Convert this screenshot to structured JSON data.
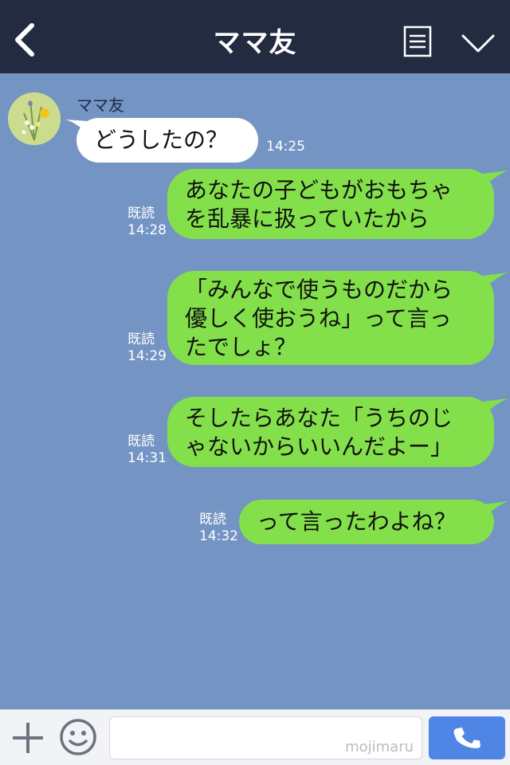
{
  "header": {
    "title": "ママ友",
    "back_icon": "chevron-left-icon",
    "menu_icon": "document-menu-icon",
    "collapse_icon": "chevron-down-icon"
  },
  "contact": {
    "name": "ママ友",
    "avatar_icon": "flower-avatar"
  },
  "messages": [
    {
      "side": "left",
      "lines": [
        "どうしたの？"
      ],
      "time": "14:25"
    },
    {
      "side": "right",
      "lines": [
        "あなたの子どもがおもちゃ",
        "を乱暴に扱っていたから"
      ],
      "read": "既読",
      "time": "14:28"
    },
    {
      "side": "right",
      "lines": [
        "「みんなで使うものだから",
        "優しく使おうね」って言っ",
        "たでしょ？"
      ],
      "read": "既読",
      "time": "14:29"
    },
    {
      "side": "right",
      "lines": [
        "そしたらあなた「うちのじ",
        "ゃないからいいんだよー」"
      ],
      "read": "既読",
      "time": "14:31"
    },
    {
      "side": "right",
      "lines": [
        "って言ったわよね？"
      ],
      "read": "既読",
      "time": "14:32"
    }
  ],
  "input": {
    "placeholder": "",
    "watermark": "mojimaru",
    "plus_icon": "plus-icon",
    "emoji_icon": "smiley-icon",
    "call_icon": "phone-icon"
  },
  "colors": {
    "header_bg": "#222b40",
    "chat_bg": "#7494c4",
    "bubble_right": "#84e04a",
    "bubble_left": "#ffffff",
    "call_button": "#4f86e6"
  }
}
